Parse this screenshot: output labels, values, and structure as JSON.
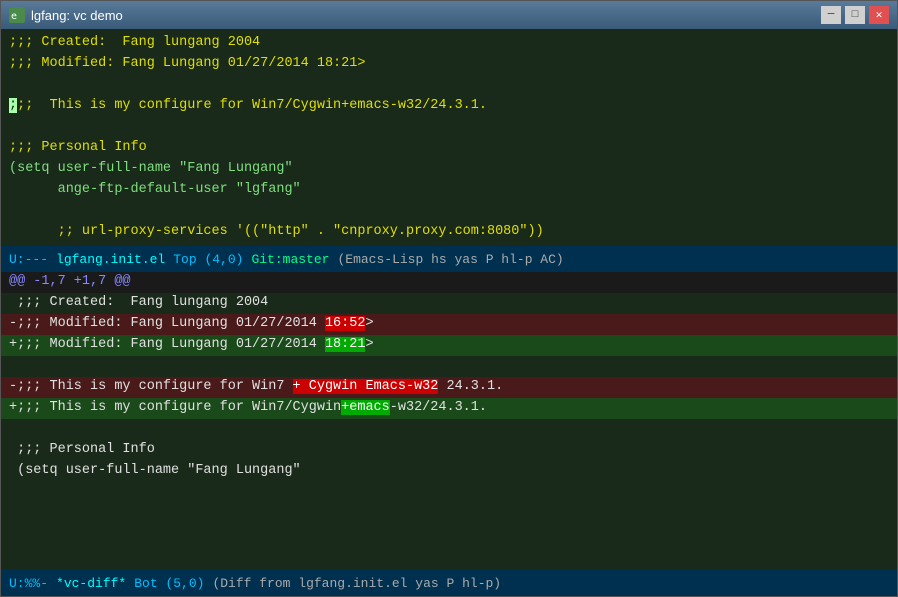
{
  "window": {
    "title": "lgfang: vc demo"
  },
  "titleBar": {
    "minimize_label": "─",
    "maximize_label": "□",
    "close_label": "✕"
  },
  "topPane": {
    "lines": [
      {
        "text": ";;; Created:  Fang lungang 2004",
        "type": "comment"
      },
      {
        "text": ";;; Modified: Fang Lungang 01/27/2014 18:21>",
        "type": "comment"
      },
      {
        "text": "",
        "type": "empty"
      },
      {
        "text": ";;; This is my configure for Win7/Cygwin+emacs-w32/24.3.1.",
        "type": "comment-cursor"
      },
      {
        "text": "",
        "type": "empty"
      },
      {
        "text": ";;; Personal Info",
        "type": "comment"
      },
      {
        "text": "(setq user-full-name \"Fang Lungang\"",
        "type": "code"
      },
      {
        "text": "      ange-ftp-default-user \"lgfang\"",
        "type": "code"
      },
      {
        "text": "",
        "type": "empty"
      },
      {
        "text": "      ;; url-proxy-services '((\"http\" . \"cnproxy.proxy.com:8080\"))",
        "type": "comment-indent"
      }
    ],
    "statusBar": {
      "mode": "U:---",
      "filename": "lgfang.init.el",
      "position": "Top (4,0)",
      "git": "Git:master",
      "modes": "(Emacs-Lisp hs yas P hl-p AC)"
    }
  },
  "bottomPane": {
    "lines": [
      {
        "text": "@@ -1,7 +1,7 @@",
        "type": "hunk"
      },
      {
        "text": " ;;; Created:  Fang lungang 2004",
        "type": "context"
      },
      {
        "text": "-;;; Modified: Fang Lungang 01/27/2014 ",
        "hl_text": "16:52",
        "suffix": ">",
        "type": "removed"
      },
      {
        "text": "+;;; Modified: Fang Lungang 01/27/2014 ",
        "hl_text": "18:21",
        "suffix": ">",
        "type": "added"
      },
      {
        "text": "",
        "type": "empty"
      },
      {
        "text": "-;;; This is my configure for Win7 ",
        "hl_text": "+ Cygwin ",
        "hl_text2": "Emacs-w32",
        "suffix2": " 24.3.1.",
        "type": "removed2"
      },
      {
        "text": "+;;; This is my configure for Win7/Cygwin",
        "hl_text": "+emacs",
        "suffix": "-w32/24.3.1.",
        "type": "added2"
      },
      {
        "text": "",
        "type": "empty"
      },
      {
        "text": " ;;; Personal Info",
        "type": "context"
      },
      {
        "text": " (setq user-full-name \"Fang Lungang\"",
        "type": "context"
      }
    ],
    "statusBar": {
      "mode": "U:%%-",
      "filename": "*vc-diff*",
      "position": "Bot (5,0)",
      "info": "(Diff from lgfang.init.el yas P hl-p)"
    }
  }
}
